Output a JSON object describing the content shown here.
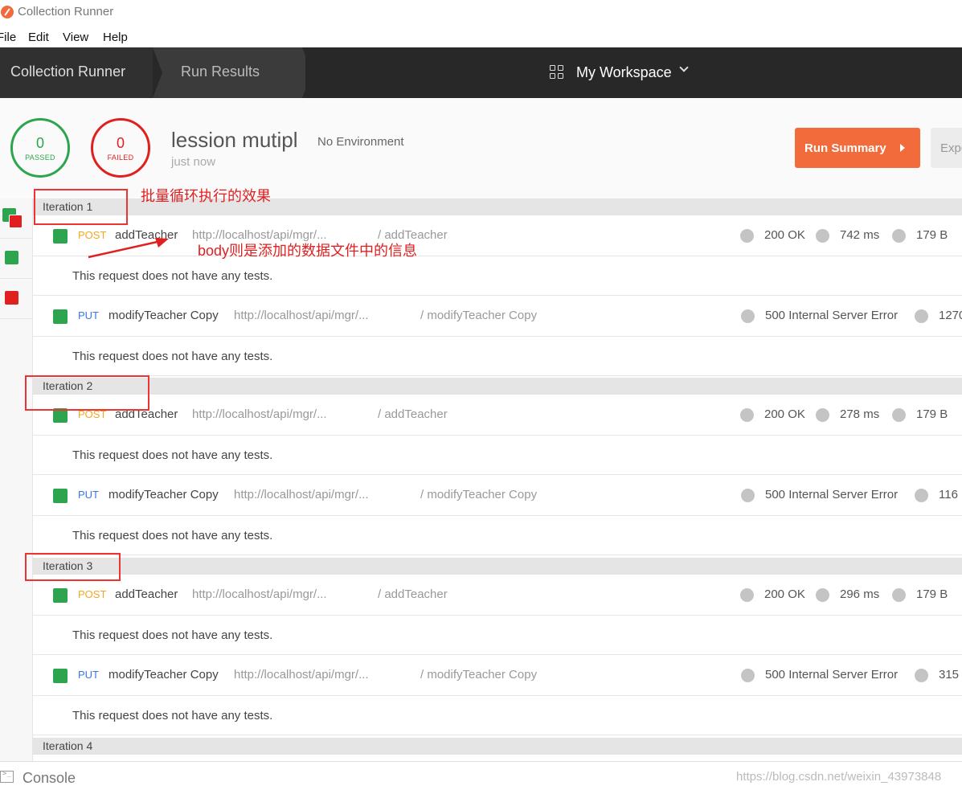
{
  "window": {
    "title": "Collection Runner"
  },
  "menu": [
    "File",
    "Edit",
    "View",
    "Help"
  ],
  "header": {
    "crumbs": [
      "Collection Runner",
      "Run Results"
    ],
    "workspace_label": "My Workspace"
  },
  "summary": {
    "passed_count": "0",
    "passed_label": "PASSED",
    "failed_count": "0",
    "failed_label": "FAILED",
    "run_name": "lession mutipl",
    "environment": "No Environment",
    "timestamp": "just now",
    "run_summary_label": "Run Summary",
    "export_label": "Expo"
  },
  "iterations": [
    {
      "label": "Iteration 1",
      "requests": [
        {
          "method": "POST",
          "name": "addTeacher",
          "url": "http://localhost/api/mgr/...",
          "path": "/ addTeacher",
          "status": "200 OK",
          "time": "742 ms",
          "size": "179 B",
          "tests_msg": "This request does not have any tests."
        },
        {
          "method": "PUT",
          "name": "modifyTeacher Copy",
          "url": "http://localhost/api/mgr/...",
          "path": "/ modifyTeacher Copy",
          "status": "500 Internal Server Error",
          "time": "1270",
          "tests_msg": "This request does not have any tests."
        }
      ]
    },
    {
      "label": "Iteration 2",
      "requests": [
        {
          "method": "POST",
          "name": "addTeacher",
          "url": "http://localhost/api/mgr/...",
          "path": "/ addTeacher",
          "status": "200 OK",
          "time": "278 ms",
          "size": "179 B",
          "tests_msg": "This request does not have any tests."
        },
        {
          "method": "PUT",
          "name": "modifyTeacher Copy",
          "url": "http://localhost/api/mgr/...",
          "path": "/ modifyTeacher Copy",
          "status": "500 Internal Server Error",
          "time": "116",
          "tests_msg": "This request does not have any tests."
        }
      ]
    },
    {
      "label": "Iteration 3",
      "requests": [
        {
          "method": "POST",
          "name": "addTeacher",
          "url": "http://localhost/api/mgr/...",
          "path": "/ addTeacher",
          "status": "200 OK",
          "time": "296 ms",
          "size": "179 B",
          "tests_msg": "This request does not have any tests."
        },
        {
          "method": "PUT",
          "name": "modifyTeacher Copy",
          "url": "http://localhost/api/mgr/...",
          "path": "/ modifyTeacher Copy",
          "status": "500 Internal Server Error",
          "time": "315",
          "tests_msg": "This request does not have any tests."
        }
      ]
    },
    {
      "label": "Iteration 4"
    }
  ],
  "annotations": {
    "note1": "批量循环执行的效果",
    "note2": "body则是添加的数据文件中的信息"
  },
  "console": {
    "label": "Console"
  },
  "watermark": "https://blog.csdn.net/weixin_43973848",
  "colors": {
    "accent": "#f26b3a",
    "pass": "#2da44e",
    "fail": "#e02020",
    "post": "#f5a623",
    "put": "#3a7bd5",
    "annotation": "#e02020"
  }
}
